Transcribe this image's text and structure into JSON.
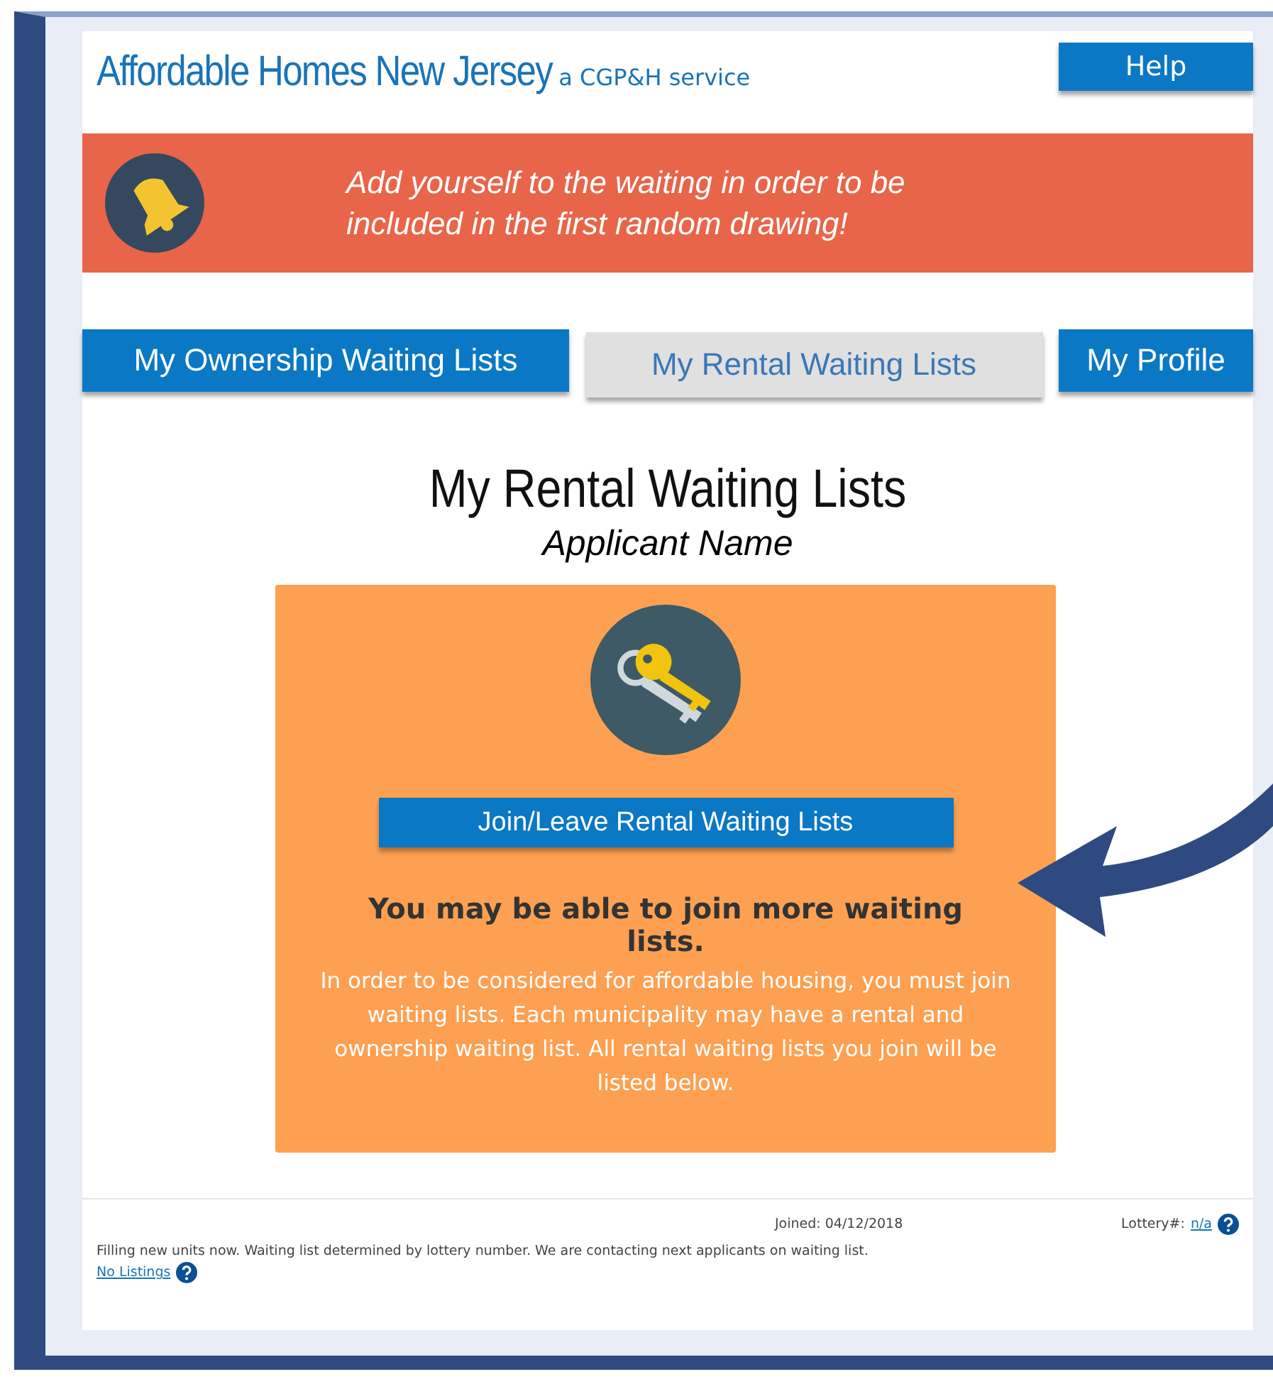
{
  "header": {
    "title": "Affordable Homes New Jersey",
    "subtitle": "a CGP&H service",
    "help_button": "Help"
  },
  "alert": {
    "message": "Add yourself to the  waiting  in order to be included in the first random drawing!"
  },
  "tabs": [
    {
      "label": "My Ownership Waiting Lists",
      "selected": false
    },
    {
      "label": "My Rental Waiting Lists",
      "selected": true
    },
    {
      "label": "My Profile",
      "selected": false
    }
  ],
  "heading": "My Rental Waiting Lists",
  "applicant": "Applicant Name",
  "card": {
    "button": "Join/Leave Rental Waiting Lists",
    "title": "You may be able to join more waiting lists.",
    "body": "In order to be considered for affordable housing, you must join waiting lists. Each municipality may have a rental and ownership waiting list. All rental waiting lists you join will be listed below."
  },
  "footer": {
    "joined": "Joined: 04/12/2018",
    "lottery_label": "Lottery#:",
    "lottery_link": "n/a",
    "status": "Filling new units now. Waiting list determined by lottery number. We are contacting next applicants on waiting list.",
    "listings_link": "No Listings"
  }
}
